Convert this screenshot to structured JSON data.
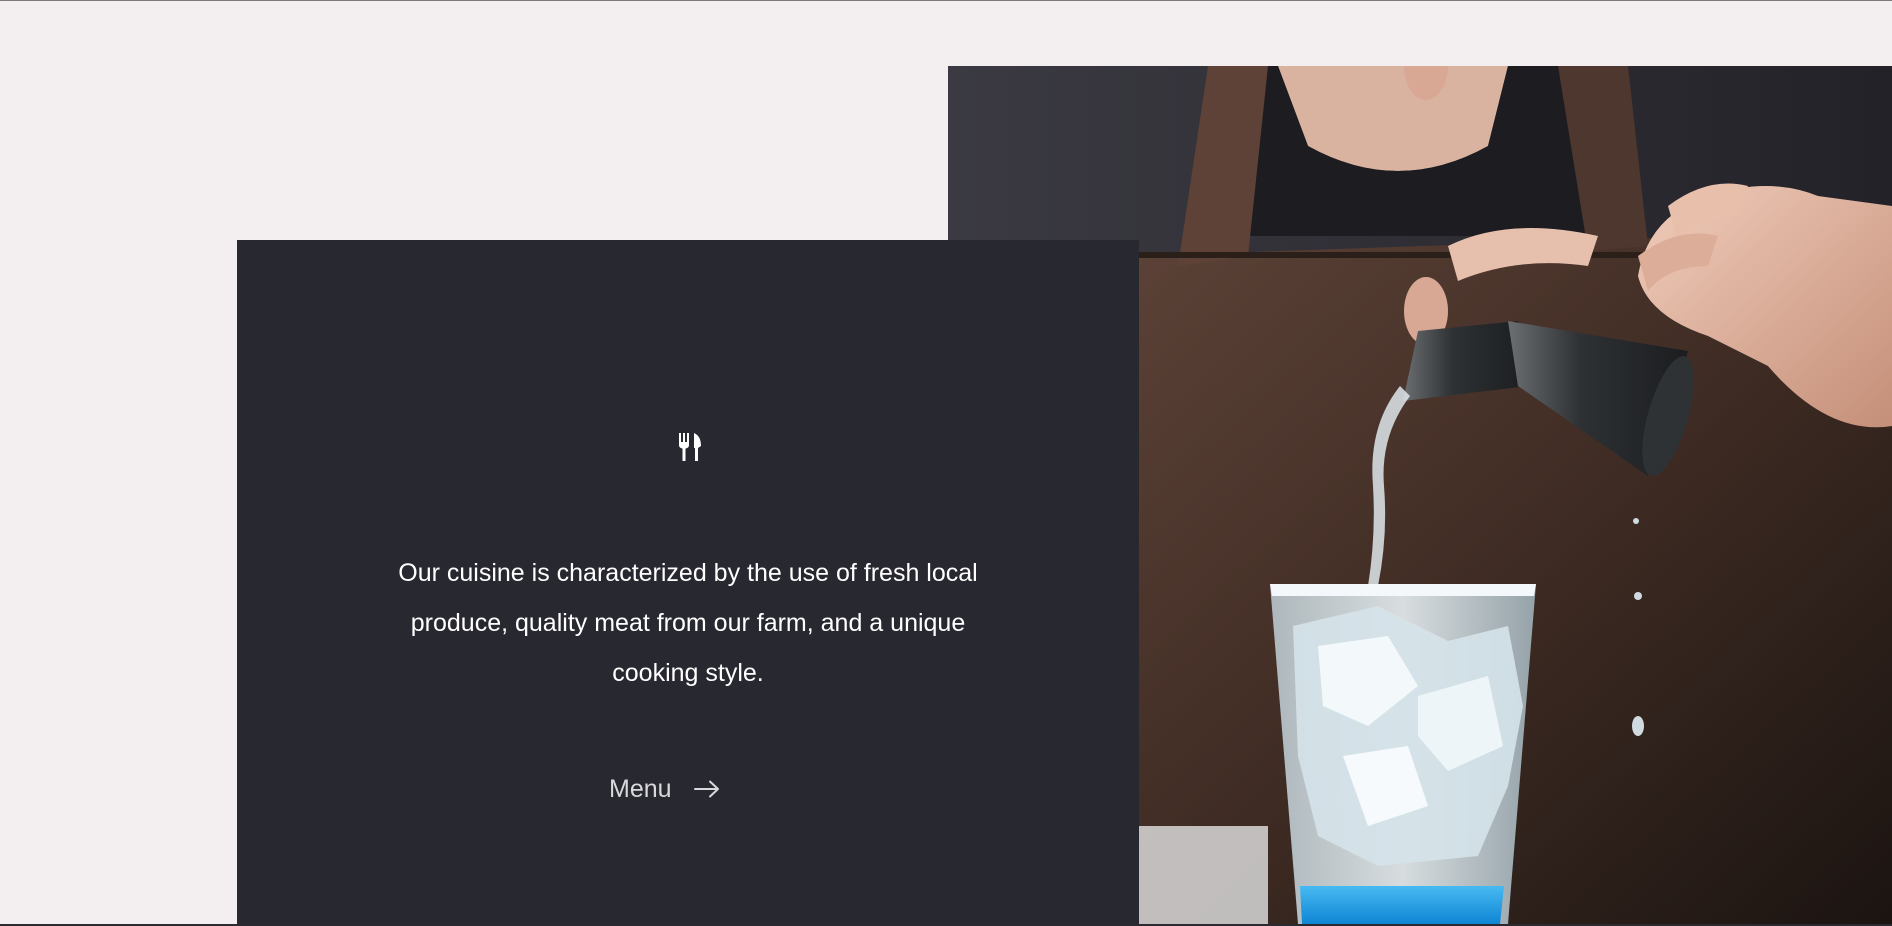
{
  "photo": {
    "description_icon": "bartender-pouring-photo"
  },
  "card": {
    "icon": "cutlery-icon",
    "tagline": "Our cuisine is characterized by the use of fresh local produce, quality meat from our farm, and a unique cooking style.",
    "menu_link": {
      "label": "Menu",
      "icon": "arrow-right-icon"
    }
  },
  "colors": {
    "page_background": "#f3eff0",
    "card_background": "#282830",
    "text": "#ffffff",
    "link_text": "#d9d9dc",
    "accent_liquid": "#1e9be6"
  }
}
